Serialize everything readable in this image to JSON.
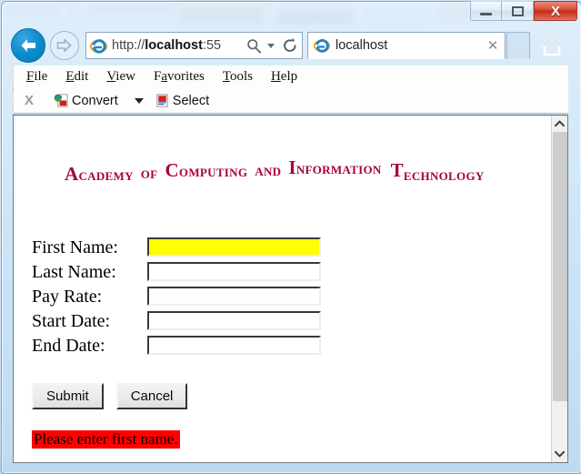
{
  "window": {
    "title_text": "localhost",
    "controls": {
      "minimize_label": "Minimize",
      "maximize_label": "Restore",
      "close_label": "X"
    }
  },
  "navigation": {
    "back_label": "Back",
    "forward_label": "Forward",
    "address_prefix": "http://",
    "address_host": "localhost",
    "address_suffix": ":55",
    "address_full": "http://localhost:55",
    "search_icon": "search-icon",
    "refresh_icon": "refresh-icon",
    "dropdown_icon": "chevron-down-icon",
    "home_icon": "home-icon"
  },
  "tab": {
    "label": "localhost",
    "close_label": "✕",
    "favicon": "internet-explorer-icon",
    "new_tab_label": ""
  },
  "menu": {
    "items": [
      {
        "pre": "",
        "accel": "F",
        "post": "ile"
      },
      {
        "pre": "",
        "accel": "E",
        "post": "dit"
      },
      {
        "pre": "",
        "accel": "V",
        "post": "iew"
      },
      {
        "pre": "F",
        "accel": "a",
        "post": "vorites"
      },
      {
        "pre": "",
        "accel": "T",
        "post": "ools"
      },
      {
        "pre": "",
        "accel": "H",
        "post": "elp"
      }
    ]
  },
  "command_bar": {
    "close_label": "X",
    "convert_label": "Convert",
    "convert_icon": "pdf-convert-icon",
    "convert_caret": "chevron-down-icon",
    "select_label": "Select",
    "select_icon": "pdf-select-icon"
  },
  "page": {
    "logo": {
      "words": [
        {
          "cap": "A",
          "rest": "CADEMY"
        },
        {
          "cap": "",
          "rest": "OF"
        },
        {
          "cap": "C",
          "rest": "OMPUTING"
        },
        {
          "cap": "",
          "rest": "AND"
        },
        {
          "cap": "I",
          "rest": "NFORMATION"
        },
        {
          "cap": "T",
          "rest": "ECHNOLOGY"
        }
      ],
      "full_text": "Academy of Computing and Information Technology",
      "color": "#a8003c"
    },
    "form": {
      "fields": [
        {
          "label": "First Name:",
          "value": "",
          "placeholder": "",
          "highlight": "#ffff00"
        },
        {
          "label": "Last Name:",
          "value": "",
          "placeholder": "",
          "highlight": ""
        },
        {
          "label": "Pay Rate:",
          "value": "",
          "placeholder": "",
          "highlight": ""
        },
        {
          "label": "Start Date:",
          "value": "",
          "placeholder": "",
          "highlight": ""
        },
        {
          "label": "End Date:",
          "value": "",
          "placeholder": "",
          "highlight": ""
        }
      ],
      "submit_label": "Submit",
      "cancel_label": "Cancel"
    },
    "error": {
      "text": "Please enter first name.",
      "background": "#ff0000",
      "color": "#000000"
    }
  },
  "scrollbar": {
    "up_arrow": "chevron-up-icon",
    "down_arrow": "chevron-down-icon"
  }
}
